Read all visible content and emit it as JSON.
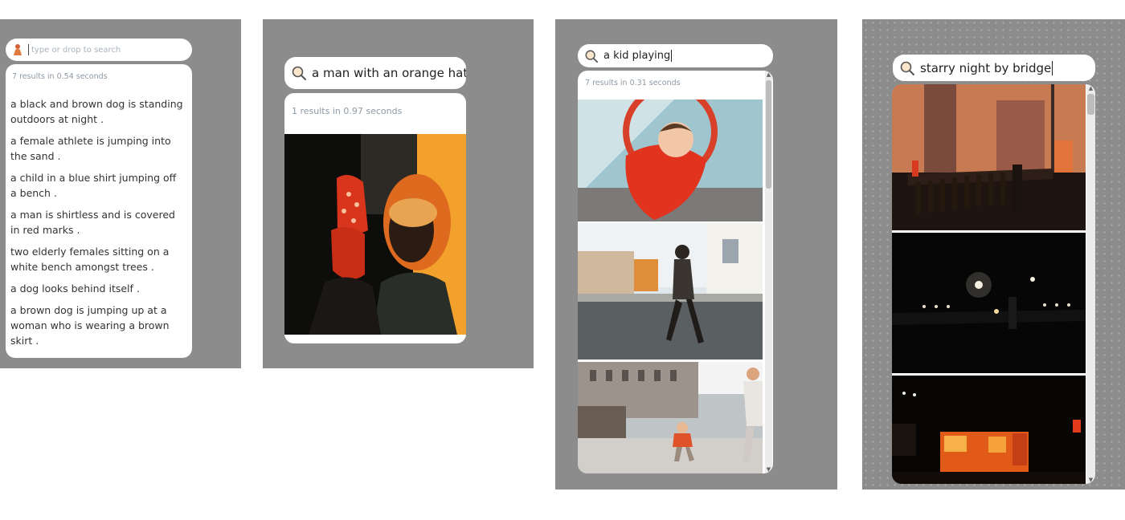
{
  "panel1": {
    "search": {
      "placeholder": "type or drop to search",
      "icon": "person-icon"
    },
    "status": "7 results in 0.54 seconds",
    "captions": [
      "a black and brown dog is standing outdoors at night .",
      "a female athlete is jumping into the sand .",
      "a child in a blue shirt jumping off a bench .",
      "a man is shirtless and is covered in red marks .",
      "two elderly females sitting on a white bench amongst trees .",
      "a dog looks behind itself .",
      "a brown dog is jumping up at a woman who is wearing a brown skirt ."
    ]
  },
  "panel2": {
    "search": {
      "query": "a man with an orange hat",
      "icon": "magnifier-icon"
    },
    "status": "1 results in 0.97 seconds",
    "images": [
      {
        "label": "two men, one wearing an orange hat"
      }
    ]
  },
  "panel3": {
    "search": {
      "query": "a kid playing",
      "icon": "magnifier-icon"
    },
    "status": "7 results in 0.31 seconds",
    "images": [
      {
        "label": "child on a red slide"
      },
      {
        "label": "girl running in a street"
      },
      {
        "label": "child walking in a town square"
      }
    ]
  },
  "panel4": {
    "search": {
      "query": "starry night by bridge",
      "icon": "magnifier-icon"
    },
    "images": [
      {
        "label": "bridge railing at sunset"
      },
      {
        "label": "road at night with street lights"
      },
      {
        "label": "night street with lit windows"
      }
    ]
  },
  "colors": {
    "panel_bg": "#8c8c8c",
    "result_bg": "#ffffff",
    "status_text": "#8e9aa6"
  }
}
